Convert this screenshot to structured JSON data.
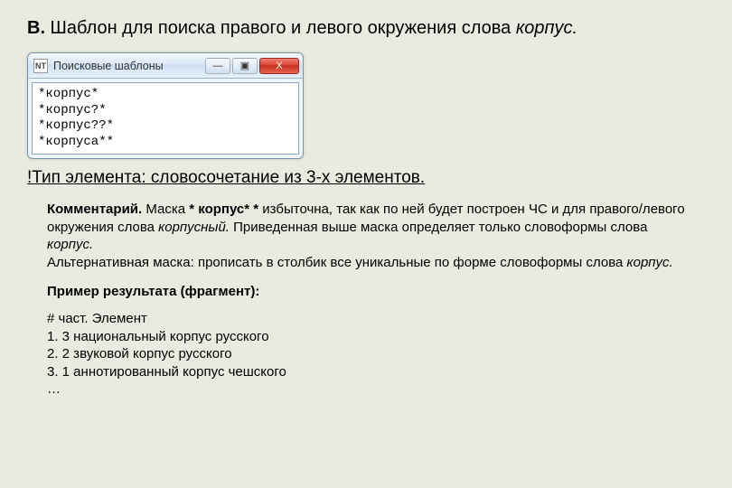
{
  "heading": {
    "prefix": "В.",
    "text": " Шаблон для поиска правого и левого окружения слова ",
    "italic_word": "корпус."
  },
  "window": {
    "icon_text": "NT",
    "title": "Поисковые шаблоны",
    "buttons": {
      "min": "—",
      "max": "▣",
      "close": "X"
    },
    "textbox_lines": [
      "*корпус*",
      "*корпус?*",
      "*корпус??*",
      "*корпуса**"
    ]
  },
  "type_line": "!Тип элемента: словосочетание из 3-х элементов.",
  "comment": {
    "label": "Комментарий.",
    "p1a": " Маска ",
    "p1b": "* корпус* *",
    "p1c": " избыточна, так как по ней будет построен ЧС и для правого/левого окружения слова ",
    "p1d": "корпусный.",
    "p1e": " Приведенная выше маска определяет только словоформы слова ",
    "p1f": "корпус.",
    "p2a": "Альтернативная маска: прописать в столбик все  уникальные по форме словоформы слова ",
    "p2b": "корпус."
  },
  "result_title": "Пример результата (фрагмент):",
  "results": [
    "# част. Элемент",
    "1. 3 национальный корпус русского",
    "2. 2 звуковой корпус русского",
    "3. 1 аннотированный корпус чешского",
    "…"
  ]
}
